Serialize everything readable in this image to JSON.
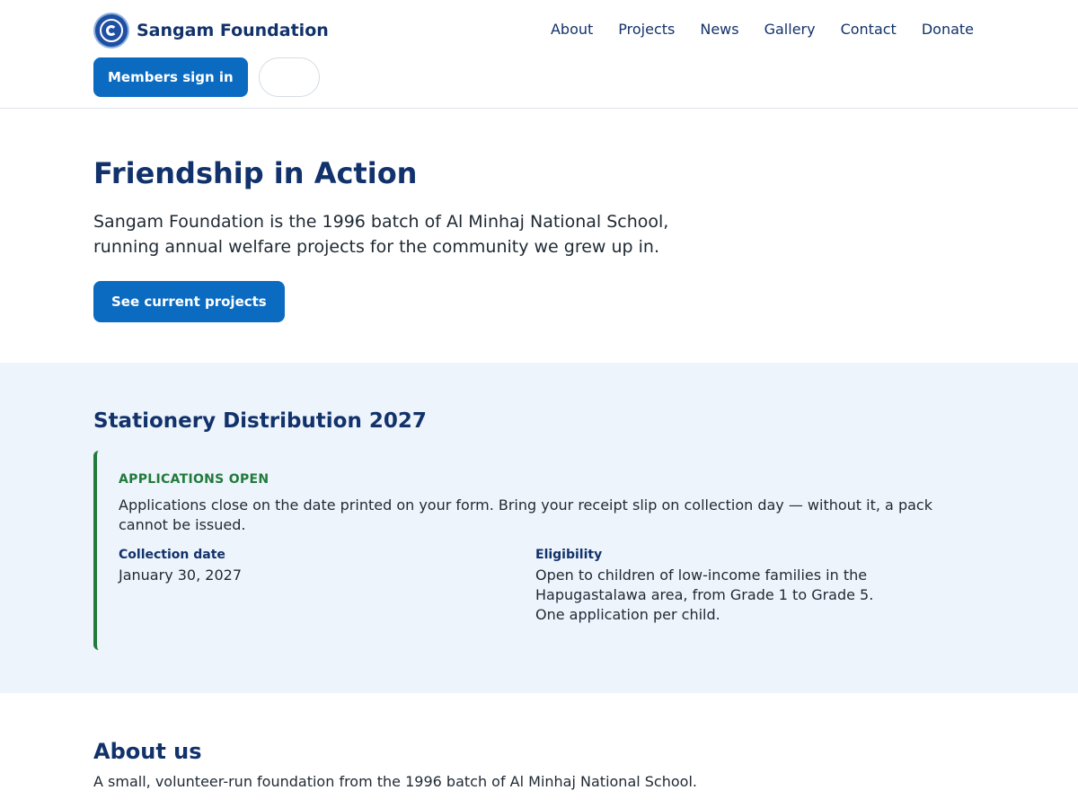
{
  "brand": {
    "name": "Sangam Foundation",
    "logo_icon": "foundation-logo-icon"
  },
  "nav": [
    "About",
    "Projects",
    "News",
    "Gallery",
    "Contact",
    "Donate"
  ],
  "header": {
    "signin_label": "Members sign in",
    "empty_button_label": ""
  },
  "hero": {
    "title": "Friendship in Action",
    "description": "Sangam Foundation is the 1996 batch of Al Minhaj National School, running annual welfare projects for the community we grew up in.",
    "cta_label": "See current projects"
  },
  "project": {
    "title": "Stationery Distribution 2027",
    "status": "APPLICATIONS OPEN",
    "message": "Applications close on the date printed on your form. Bring your receipt slip on collection day — without it, a pack cannot be issued.",
    "collection_label": "Collection date",
    "collection_value": "January 30, 2027",
    "eligibility_label": "Eligibility",
    "eligibility_value": "Open to children of low-income families in the Hapugastalawa area, from Grade 1 to Grade 5. One application per child."
  },
  "about": {
    "title": "About us",
    "text": "A small, volunteer-run foundation from the 1996 batch of Al Minhaj National School."
  },
  "colors": {
    "brand_navy": "#12326b",
    "primary_button": "#0b6bc1",
    "status_green": "#217a3c",
    "project_bg": "#eef4fb"
  }
}
